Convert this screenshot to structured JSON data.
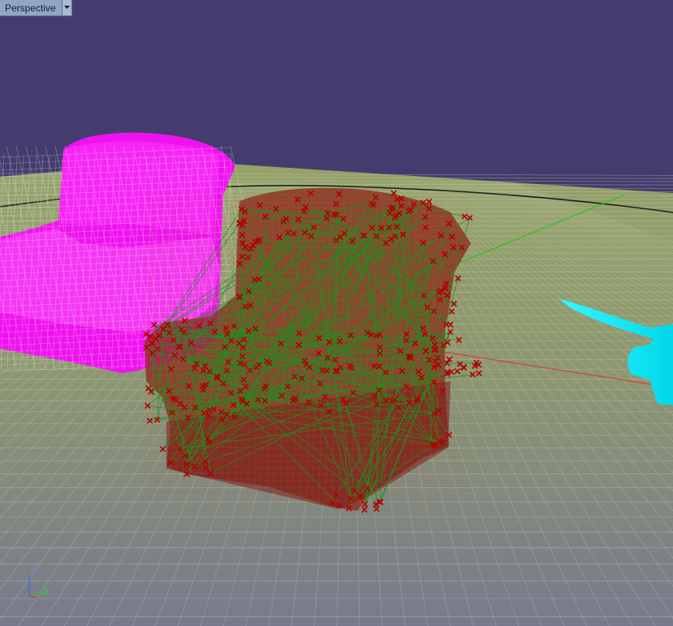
{
  "viewport": {
    "view_name": "Perspective",
    "background_color": "#443c6e",
    "ground_color": "#8f9b67",
    "grid_color": "#c8cfad",
    "x_axis_color": "#d23c3c",
    "y_axis_color": "#20c020"
  },
  "objects": [
    {
      "name": "armchair-magenta-mesh",
      "display": "wireframe",
      "color": "#ff00ff"
    },
    {
      "name": "armchair-red-with-correspondences",
      "display": "shaded-transparent",
      "color": "#8a1c16",
      "point_color": "#b30000",
      "line_color": "#1f8f1f"
    },
    {
      "name": "cyan-object-partial",
      "display": "shaded",
      "color": "#00f0ff"
    }
  ],
  "axis_gizmo": {
    "labels": [
      "z",
      "y"
    ],
    "icon": "xyz-axes-icon"
  }
}
